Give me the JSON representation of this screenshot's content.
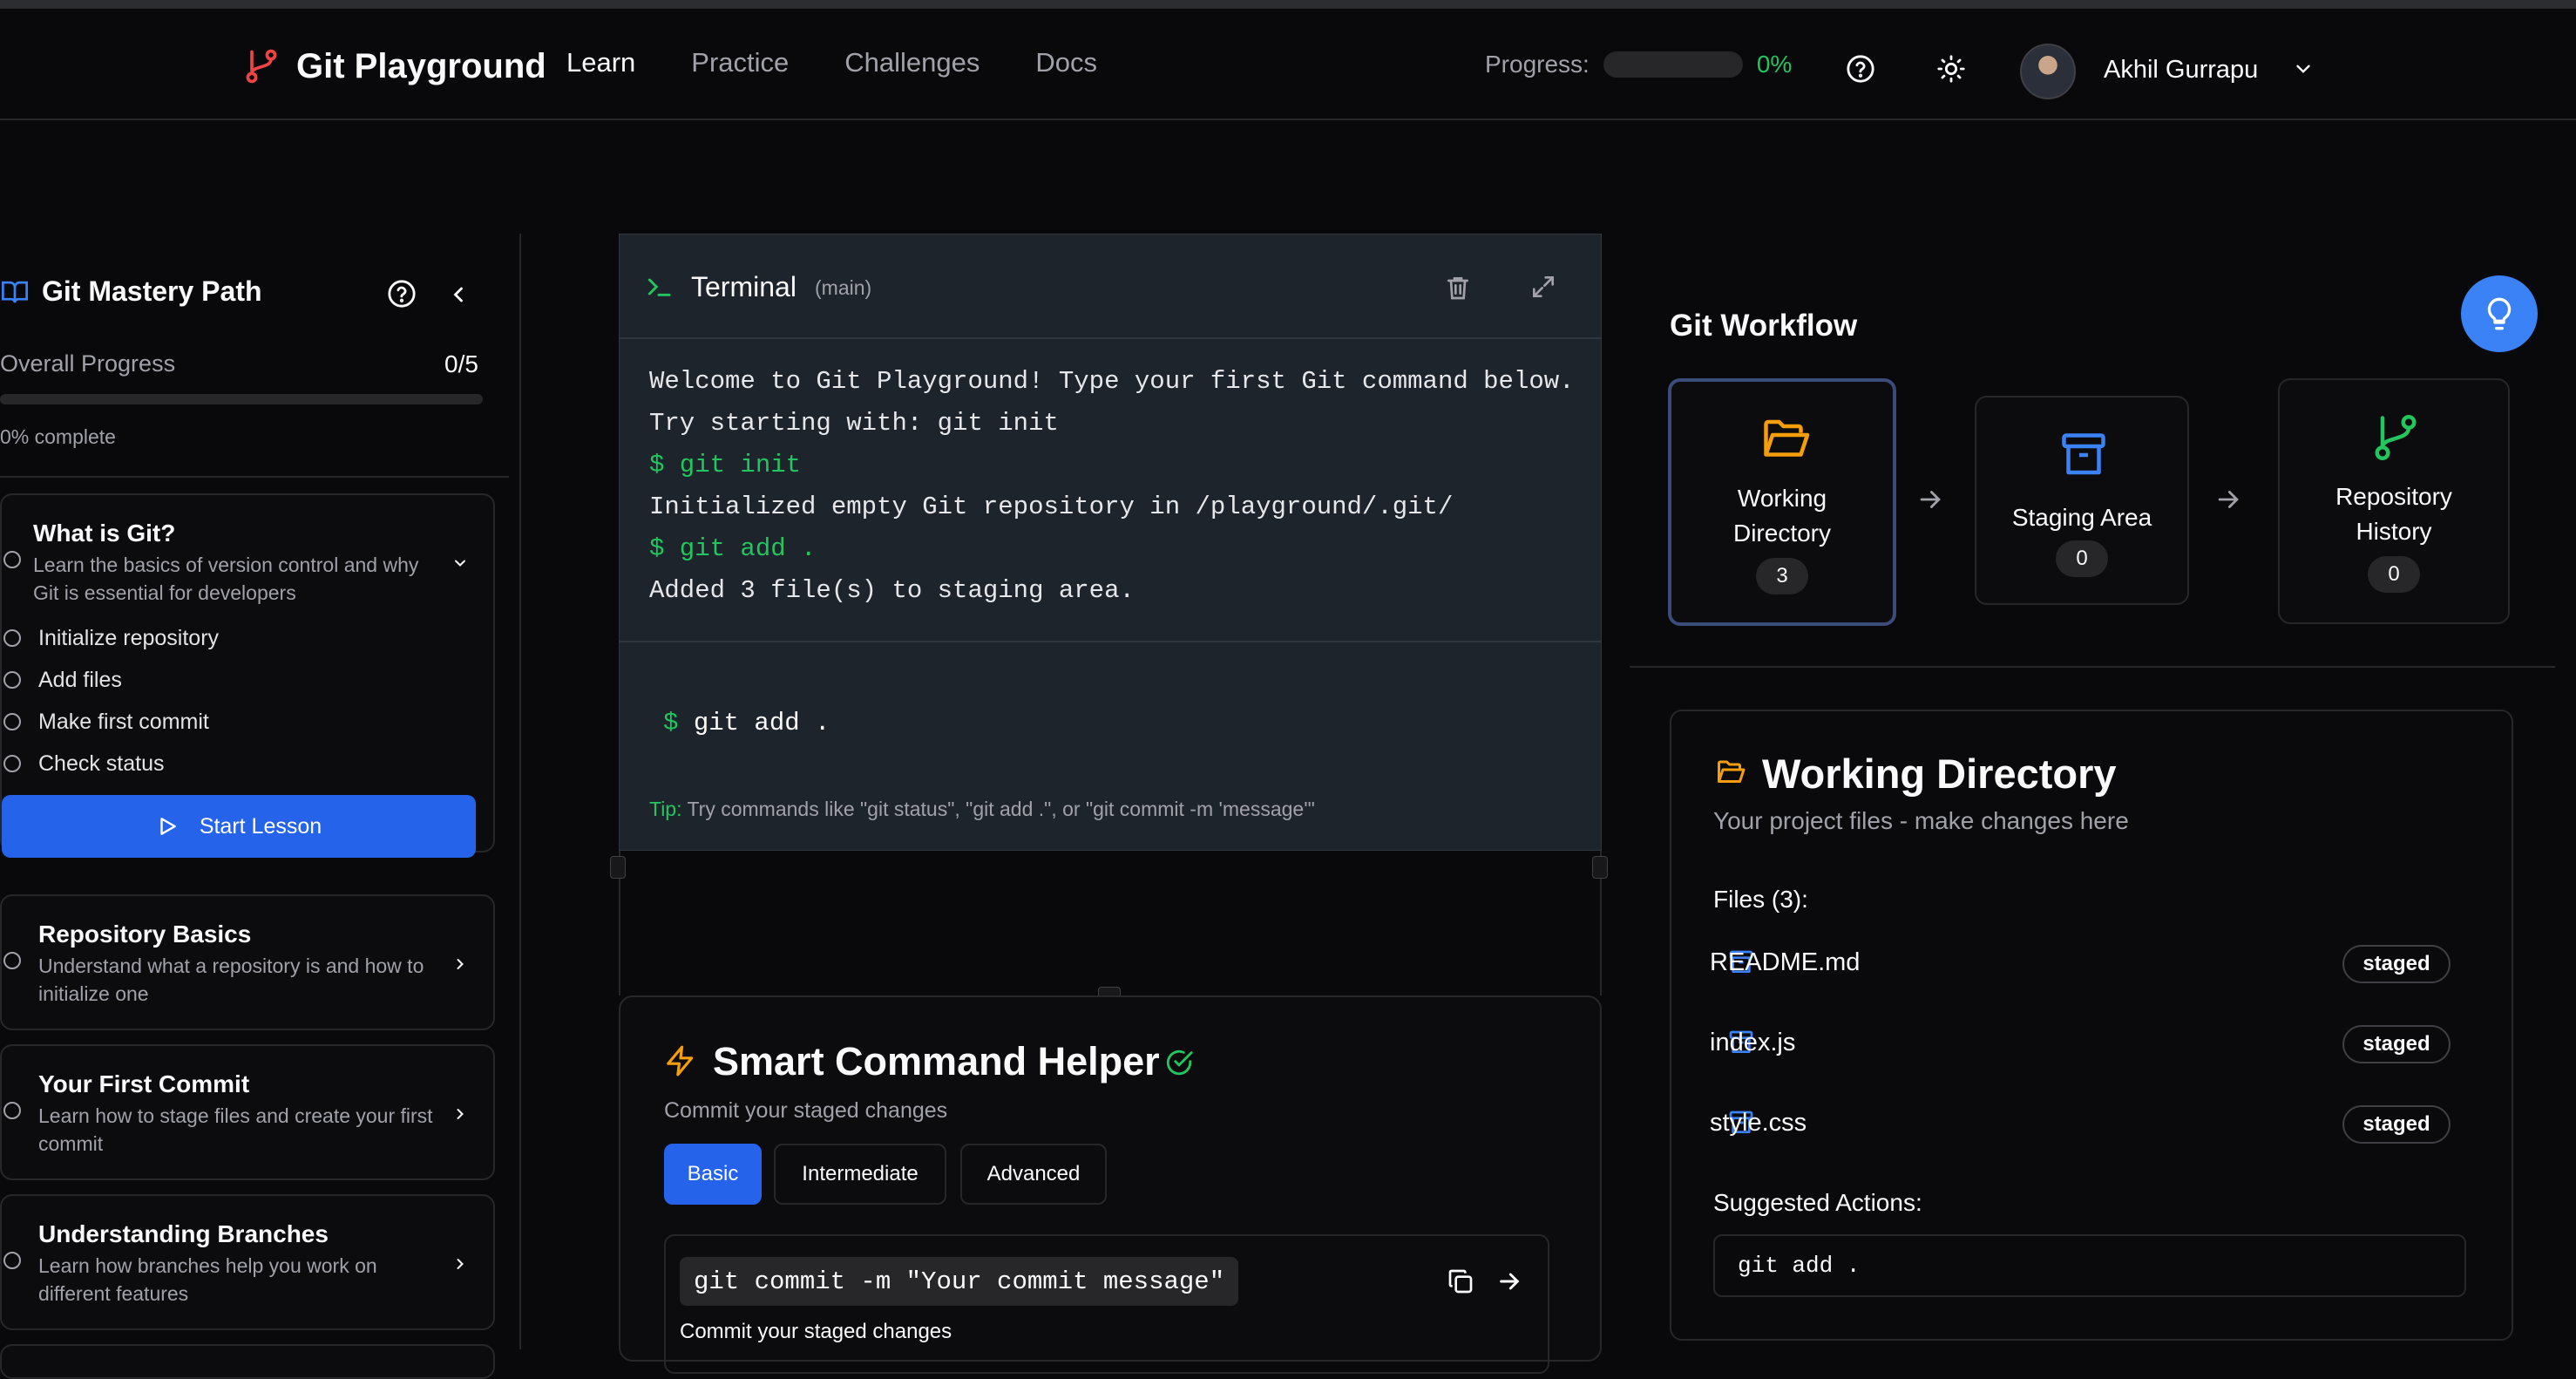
{
  "header": {
    "brand": "Git Playground",
    "nav": [
      "Learn",
      "Practice",
      "Challenges",
      "Docs"
    ],
    "progress_label": "Progress:",
    "progress_value": "0%",
    "user_name": "Akhil Gurrapu"
  },
  "sidebar": {
    "title": "Git Mastery Path",
    "overall_label": "Overall Progress",
    "overall_count": "0/5",
    "complete_text": "0% complete",
    "modules": [
      {
        "title": "What is Git?",
        "desc": "Learn the basics of version control and why Git is essential for developers",
        "steps": [
          "Initialize repository",
          "Add files",
          "Make first commit",
          "Check status"
        ],
        "button": "Start Lesson"
      },
      {
        "title": "Repository Basics",
        "desc": "Understand what a repository is and how to initialize one"
      },
      {
        "title": "Your First Commit",
        "desc": "Learn how to stage files and create your first commit"
      },
      {
        "title": "Understanding Branches",
        "desc": "Learn how branches help you work on different features"
      }
    ]
  },
  "terminal": {
    "title": "Terminal",
    "branch": "(main)",
    "lines": [
      {
        "text": "Welcome to Git Playground! Type your first Git command below.",
        "kind": "out"
      },
      {
        "text": "Try starting with: git init",
        "kind": "out"
      },
      {
        "text": "$ git init",
        "kind": "cmd"
      },
      {
        "text": "Initialized empty Git repository in /playground/.git/",
        "kind": "out"
      },
      {
        "text": "$ git add .",
        "kind": "cmd"
      },
      {
        "text": "Added 3 file(s) to staging area.",
        "kind": "out"
      }
    ],
    "prompt": "$",
    "input_value": "git add .",
    "tip_label": "Tip:",
    "tip_text": "Try commands like \"git status\", \"git add .\", or \"git commit -m 'message'\""
  },
  "helper": {
    "title": "Smart Command Helper",
    "subtitle": "Commit your staged changes",
    "tabs": [
      "Basic",
      "Intermediate",
      "Advanced"
    ],
    "active_tab": "Basic",
    "command": "git commit -m \"Your commit message\"",
    "command_desc": "Commit your staged changes"
  },
  "workflow": {
    "title": "Git Workflow",
    "stages": [
      {
        "label": "Working Directory",
        "count": "3",
        "color": "#f59e0b"
      },
      {
        "label": "Staging Area",
        "count": "0",
        "color": "#3b82f6"
      },
      {
        "label": "Repository History",
        "count": "0",
        "color": "#22c55e"
      }
    ]
  },
  "workdir": {
    "title": "Working Directory",
    "subtitle": "Your project files - make changes here",
    "files_label": "Files (3):",
    "files": [
      {
        "name": "README.md",
        "status": "staged"
      },
      {
        "name": "index.js",
        "status": "staged"
      },
      {
        "name": "style.css",
        "status": "staged"
      }
    ],
    "suggested_label": "Suggested Actions:",
    "suggested_command": "git add ."
  },
  "colors": {
    "accent": "#3b82f6",
    "success": "#22c55e",
    "warning": "#f59e0b",
    "background": "#09090b"
  }
}
